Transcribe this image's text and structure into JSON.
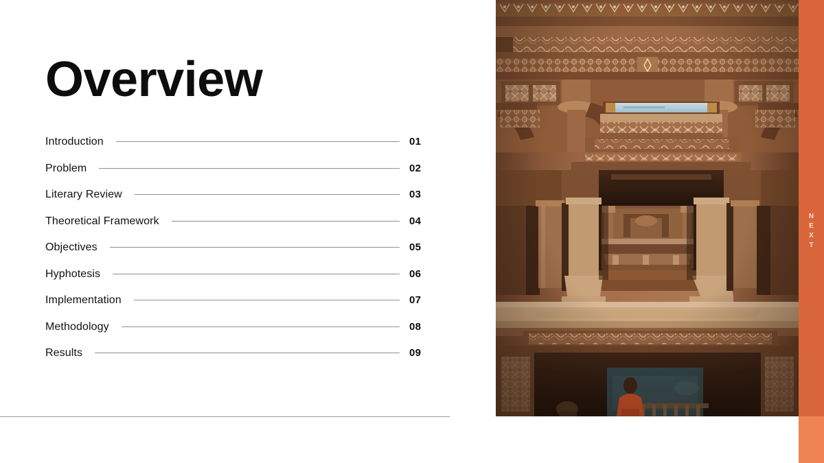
{
  "slide": {
    "title": "Overview",
    "side_tab_label": "NEXT"
  },
  "toc": {
    "items": [
      {
        "label": "Introduction",
        "number": "01"
      },
      {
        "label": "Problem",
        "number": "02"
      },
      {
        "label": "Literary Review",
        "number": "03"
      },
      {
        "label": "Theoretical Framework",
        "number": "04"
      },
      {
        "label": "Objectives",
        "number": "05"
      },
      {
        "label": "Hyphotesis",
        "number": "06"
      },
      {
        "label": "Implementation",
        "number": "07"
      },
      {
        "label": "Methodology",
        "number": "08"
      },
      {
        "label": "Results",
        "number": "09"
      }
    ]
  },
  "photo": {
    "description": "Ornate carved sandstone stepwell interior with tiered pillars and a visitor in an orange shirt"
  },
  "colors": {
    "accent_orange": "#ef8354",
    "accent_orange_dark": "#d9663a",
    "rule_gray": "#8f8f8f",
    "text_black": "#0d0d0d",
    "background": "#ffffff"
  }
}
